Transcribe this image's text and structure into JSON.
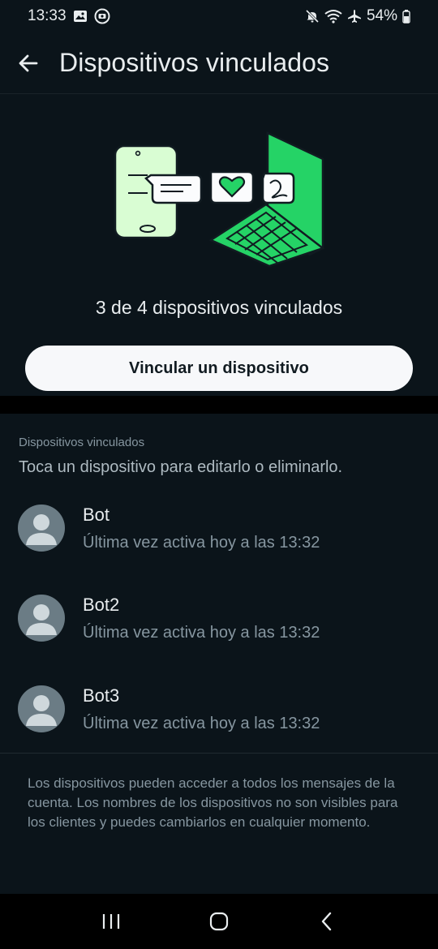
{
  "status_bar": {
    "time": "13:33",
    "battery": "54%",
    "left_icons": [
      "gallery-icon",
      "media-icon"
    ],
    "right_icons": [
      "mute-icon",
      "wifi-icon",
      "airplane-icon",
      "battery-icon"
    ]
  },
  "app_bar": {
    "title": "Dispositivos vinculados",
    "back_icon": "arrow-left-icon"
  },
  "hero": {
    "count_text": "3 de 4 dispositivos vinculados",
    "link_button_label": "Vincular un dispositivo"
  },
  "devices_section": {
    "header": "Dispositivos vinculados",
    "hint": "Toca un dispositivo para editarlo o eliminarlo.",
    "devices": [
      {
        "name": "Bot",
        "last_active": "Última vez activa hoy a las 13:32"
      },
      {
        "name": "Bot2",
        "last_active": "Última vez activa hoy a las 13:32"
      },
      {
        "name": "Bot3",
        "last_active": "Última vez activa hoy a las 13:32"
      }
    ],
    "footer_note": "Los dispositivos pueden acceder a todos los mensajes de la cuenta. Los nombres de los dispositivos no son visibles para los clientes y puedes cambiarlos en cualquier momento."
  },
  "nav_bar": {
    "buttons": [
      "recent-apps-icon",
      "home-icon",
      "back-icon"
    ]
  },
  "colors": {
    "background": "#0b141a",
    "accent_green": "#25d366",
    "light_green": "#d9fdd3",
    "button_bg": "#f7f8fa",
    "secondary_text": "#8696a0"
  }
}
